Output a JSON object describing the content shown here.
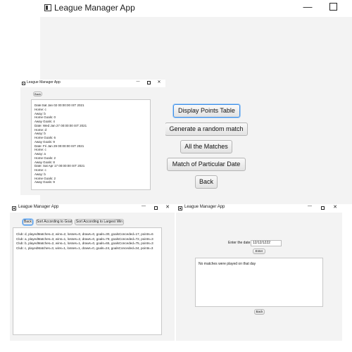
{
  "main_window": {
    "title": "League Manager App",
    "buttons": {
      "points_table": "Display Points Table",
      "random_match": "Generate a random match",
      "all_matches": "All the Matches",
      "particular_date": "Match of Particular Date",
      "back": "Back"
    }
  },
  "matches_window": {
    "title": "League Manager App",
    "back": "Back",
    "lines": [
      "Date:Sat Jan 02 00:00:00 IST 2021",
      "Home: c",
      "Away: b",
      "Home Goals: 0",
      "Away Goals: 4",
      "Date: Wed Jan 27 00:00:00 IST 2021",
      "Home: d",
      "Away: b",
      "Home Goals: 6",
      "Away Goals: 9",
      "Date: Fri Jan 29 00:00:00 IST 2021",
      "Home: c",
      "Away: a",
      "Home Goals: 2",
      "Away Goals: 8",
      "Date: Sat Apr 17 00:00:00 IST 2021",
      "Home: c",
      "Away: b",
      "Home Goals: 2",
      "Away Goals: 9"
    ]
  },
  "table_window": {
    "title": "League Manager App",
    "back": "Back",
    "sort_goal": "Sort According to Goal",
    "sort_win": "Sort According to Largest Win",
    "rows": [
      "Club: d, playedMatches=2, wins=2, losses=0, draws=0, goals=30, goalsConceded=17, points=6",
      "Club: a, playedMatches=3, wins=1, losses=2, draws=0, goals=79, goalsConceded=72, points=3",
      "Club: b, playedMatches=2, wins=1, losses=1, draws=0, goals=65, goalsConceded=75, points=3",
      "Club: c, playedMatches=3, wins=1, losses=1, draws=0, goals=24, goalsConceded=34, points=3"
    ]
  },
  "date_window": {
    "title": "League Manager App",
    "date_label": "Enter the date",
    "date_value": "12/12/1222",
    "enter": "Enter",
    "result": "No matches were played on that day",
    "back": "Back"
  }
}
